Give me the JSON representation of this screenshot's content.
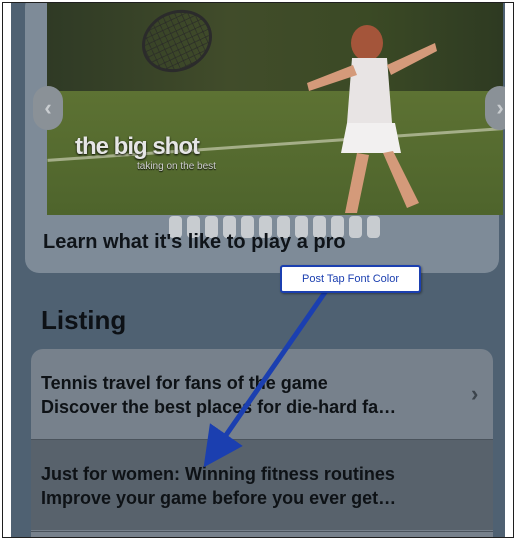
{
  "carousel": {
    "image_caption_big": "the big shot",
    "image_caption_small": "taking on the best",
    "caption": "Learn what it's like to play a pro",
    "page_count": 12,
    "prev_icon": "chevron-left-icon",
    "next_icon": "chevron-right-icon"
  },
  "listing": {
    "title": "Listing",
    "items": [
      {
        "title": "Tennis travel for fans of the game",
        "subtitle": "Discover the best places for die-hard fa…",
        "chevron_icon": "chevron-right-icon"
      },
      {
        "title": "Just for women: Winning fitness routines",
        "subtitle": "Improve your game before you ever get…"
      }
    ]
  },
  "annotation": {
    "label": "Post Tap Font Color",
    "color": "#1b3fb0"
  }
}
